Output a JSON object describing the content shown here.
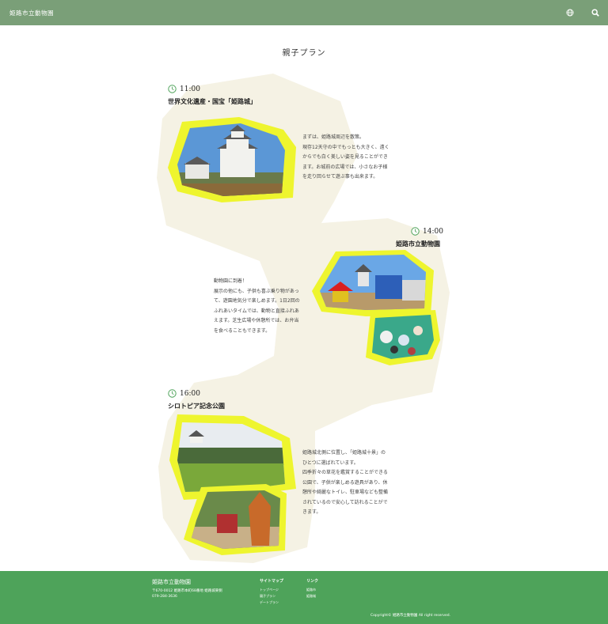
{
  "header": {
    "site_title": "姫路市立動物園",
    "icons": [
      "globe-icon",
      "search-icon"
    ]
  },
  "page_title": "親子プラン",
  "plan": [
    {
      "time": "11:00",
      "spot": "世界文化遺産・国宝「姫路城」",
      "desc": [
        "まずは、姫路城周辺を散策。",
        "現存12天守の中でもっとも大きく、遠く",
        "からでも白く美しい姿を見ることができ",
        "ます。お城前の広場では、小さなお子様",
        "を走り回らせて遊ぶ事も出来ます。"
      ]
    },
    {
      "time": "14:00",
      "spot": "姫路市立動物園",
      "desc": [
        "動物園に到着！",
        "展示の他にも、子供も喜ぶ乗り物があっ",
        "て、遊園地気分で楽しめます。1日2回の",
        "ふれあいタイムでは、動物と直接ふれあ",
        "えます。芝生広場や休憩所では、お弁当",
        "を食べることもできます。"
      ]
    },
    {
      "time": "16:00",
      "spot": "シロトピア記念公園",
      "desc": [
        "姫路城北側に位置し、「姫路城十景」の",
        "ひとつに選ばれています。",
        "四季折々の草花を鑑賞することができる",
        "公園で、子供が楽しめる遊具があり、休",
        "憩所や綺麗なトイレ、駐車場なども整備",
        "されているので安心して訪れることがで",
        "きます。"
      ]
    }
  ],
  "footer": {
    "name": "姫路市立動物園",
    "address": "〒670-0012 姫路市本町68番地 姫路城東側",
    "tel": "079-284-3636",
    "sitemap_title": "サイトマップ",
    "sitemap_links": [
      "トップページ",
      "親子プラン",
      "デートプラン"
    ],
    "link_title": "リンク",
    "links": [
      "姫路市",
      "姫路城"
    ],
    "copyright": "Copyright© 姫路市立動物園 All right reserved."
  },
  "colors": {
    "header": "#7a9f78",
    "footer": "#4ea35a",
    "blob": "#f5f2e4",
    "accent_yellow": "#eef52e"
  }
}
